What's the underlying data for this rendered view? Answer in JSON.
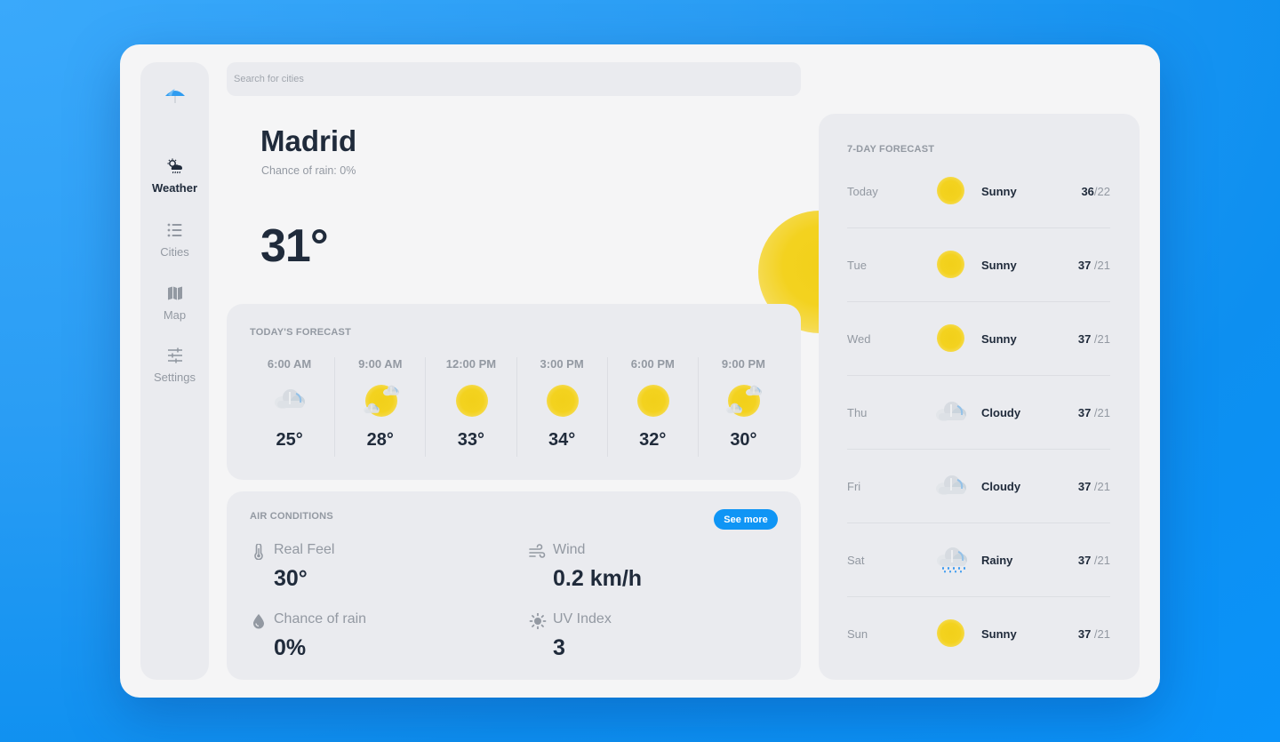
{
  "search": {
    "placeholder": "Search for cities",
    "value": ""
  },
  "sidebar": {
    "logo_icon": "umbrella-icon",
    "items": [
      {
        "label": "Weather",
        "icon": "cloud-sun-rain-icon",
        "active": true
      },
      {
        "label": "Cities",
        "icon": "list-icon",
        "active": false
      },
      {
        "label": "Map",
        "icon": "map-icon",
        "active": false
      },
      {
        "label": "Settings",
        "icon": "sliders-icon",
        "active": false
      }
    ]
  },
  "current": {
    "city": "Madrid",
    "rain_chance_label": "Chance of rain: 0%",
    "temperature": "31°",
    "icon": "sun-icon"
  },
  "todays_forecast": {
    "title": "TODAY'S FORECAST",
    "hours": [
      {
        "time": "6:00 AM",
        "icon": "cloudy-icon",
        "temp": "25°"
      },
      {
        "time": "9:00 AM",
        "icon": "partly-cloudy-icon",
        "temp": "28°"
      },
      {
        "time": "12:00 PM",
        "icon": "sun-icon",
        "temp": "33°"
      },
      {
        "time": "3:00 PM",
        "icon": "sun-icon",
        "temp": "34°"
      },
      {
        "time": "6:00 PM",
        "icon": "sun-icon",
        "temp": "32°"
      },
      {
        "time": "9:00 PM",
        "icon": "partly-cloudy-icon",
        "temp": "30°"
      }
    ]
  },
  "air_conditions": {
    "title": "AIR CONDITIONS",
    "see_more_label": "See more",
    "items": [
      {
        "label": "Real Feel",
        "value": "30°",
        "icon": "thermometer-icon"
      },
      {
        "label": "Wind",
        "value": "0.2 km/h",
        "icon": "wind-icon"
      },
      {
        "label": "Chance of rain",
        "value": "0%",
        "icon": "droplet-icon"
      },
      {
        "label": "UV Index",
        "value": "3",
        "icon": "sun-uv-icon"
      }
    ]
  },
  "weekly_forecast": {
    "title": "7-DAY FORECAST",
    "days": [
      {
        "day": "Today",
        "icon": "sun-icon",
        "condition": "Sunny",
        "high": "36",
        "low": "/22"
      },
      {
        "day": "Tue",
        "icon": "sun-icon",
        "condition": "Sunny",
        "high": "37",
        "low": " /21"
      },
      {
        "day": "Wed",
        "icon": "sun-icon",
        "condition": "Sunny",
        "high": "37",
        "low": " /21"
      },
      {
        "day": "Thu",
        "icon": "cloudy-icon",
        "condition": "Cloudy",
        "high": "37",
        "low": " /21"
      },
      {
        "day": "Fri",
        "icon": "cloudy-icon",
        "condition": "Cloudy",
        "high": "37",
        "low": " /21"
      },
      {
        "day": "Sat",
        "icon": "rain-icon",
        "condition": "Rainy",
        "high": "37",
        "low": " /21"
      },
      {
        "day": "Sun",
        "icon": "sun-icon",
        "condition": "Sunny",
        "high": "37",
        "low": " /21"
      }
    ]
  },
  "colors": {
    "accent": "#0f95f5",
    "text_dark": "#202b3b",
    "text_muted": "#9399a2",
    "card_bg": "#eaebef",
    "app_bg": "#f5f5f6",
    "sun": "#f2d01a"
  }
}
